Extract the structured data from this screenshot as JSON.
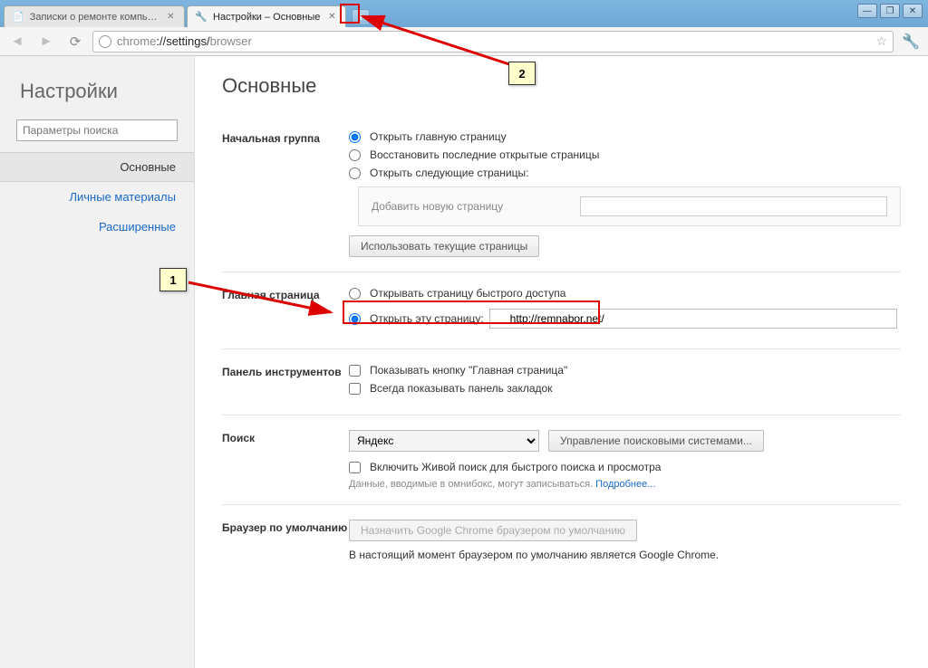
{
  "tabs": {
    "t0": {
      "title": "Записки о ремонте компьюте"
    },
    "t1": {
      "title": "Настройки – Основные"
    }
  },
  "url": {
    "pre": "chrome",
    "mid": "://settings/",
    "post": "browser"
  },
  "sidebar": {
    "title": "Настройки",
    "search_placeholder": "Параметры поиска",
    "items": {
      "i0": "Основные",
      "i1": "Личные материалы",
      "i2": "Расширенные"
    }
  },
  "content": {
    "heading": "Основные",
    "startup": {
      "label": "Начальная группа",
      "r0": "Открыть главную страницу",
      "r1": "Восстановить последние открытые страницы",
      "r2": "Открыть следующие страницы:",
      "add_label": "Добавить новую страницу",
      "use_current": "Использовать текущие страницы"
    },
    "homepage": {
      "label": "Главная страница",
      "r0": "Открывать страницу быстрого доступа",
      "r1": "Открыть эту страницу:",
      "url": "http://remnabor.net/"
    },
    "toolbar": {
      "label": "Панель инструментов",
      "c0": "Показывать кнопку \"Главная страница\"",
      "c1": "Всегда показывать панель закладок"
    },
    "search": {
      "label": "Поиск",
      "engine": "Яндекс",
      "manage": "Управление поисковыми системами...",
      "instant": "Включить Живой поиск для быстрого поиска и просмотра",
      "note": "Данные, вводимые в омнибокс, могут записываться.",
      "more": "Подробнее..."
    },
    "default": {
      "label": "Браузер по умолчанию",
      "btn": "Назначить Google Chrome браузером по умолчанию",
      "status": "В настоящий момент браузером по умолчанию является Google Chrome."
    }
  },
  "annot": {
    "a1": "1",
    "a2": "2"
  }
}
